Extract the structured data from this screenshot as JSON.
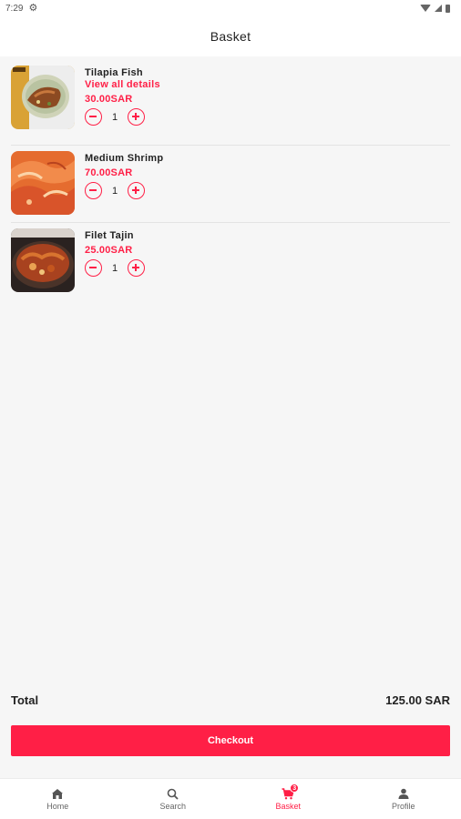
{
  "status_bar": {
    "time": "7:29"
  },
  "header": {
    "title": "Basket"
  },
  "items": [
    {
      "name": "Tilapia Fish",
      "details_link": "View all details",
      "price": "30.00SAR",
      "quantity": "1"
    },
    {
      "name": "Medium Shrimp",
      "price": "70.00SAR",
      "quantity": "1"
    },
    {
      "name": "Filet Tajin",
      "price": "25.00SAR",
      "quantity": "1"
    }
  ],
  "summary": {
    "total_label": "Total",
    "total_value": "125.00 SAR"
  },
  "checkout": {
    "label": "Checkout"
  },
  "nav": {
    "items": [
      {
        "label": "Home",
        "icon": "home-icon"
      },
      {
        "label": "Search",
        "icon": "search-icon"
      },
      {
        "label": "Basket",
        "icon": "cart-icon",
        "badge": "3",
        "active": true
      },
      {
        "label": "Profile",
        "icon": "person-icon"
      }
    ]
  },
  "colors": {
    "accent": "#ff1f46",
    "background": "#f6f6f6"
  }
}
